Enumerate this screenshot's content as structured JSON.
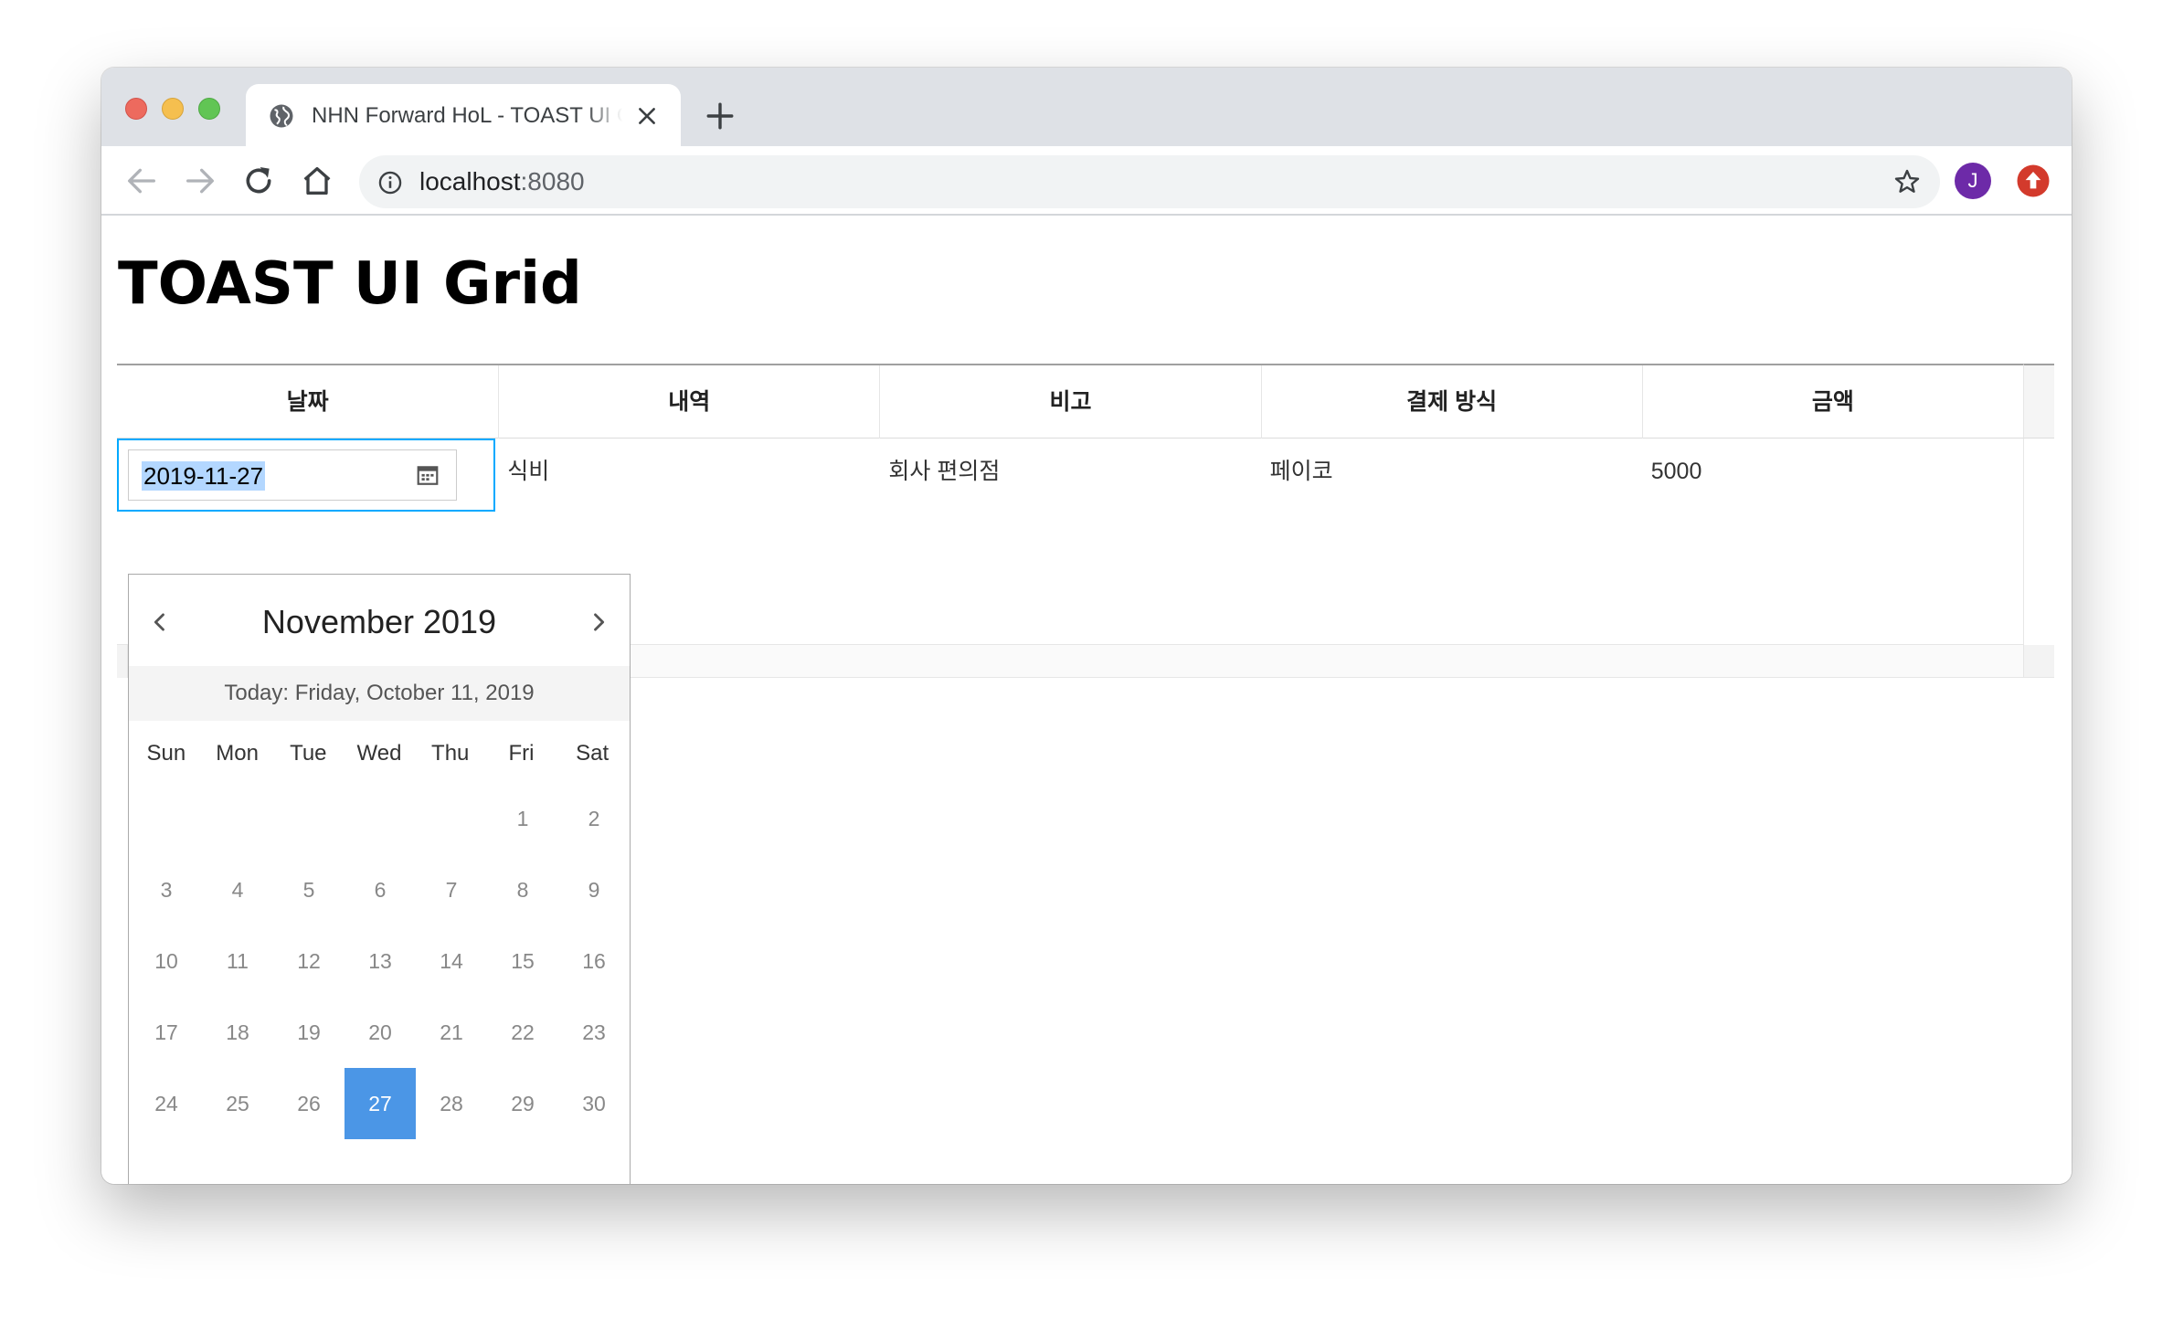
{
  "browser": {
    "tab_title": "NHN Forward HoL - TOAST UI Grid",
    "url_host": "localhost",
    "url_port": ":8080",
    "avatar_letter": "J"
  },
  "page": {
    "title": "TOAST UI Grid"
  },
  "grid": {
    "columns": [
      "날짜",
      "내역",
      "비고",
      "결제 방식",
      "금액"
    ],
    "rows": [
      [
        "2019-11-27",
        "식비",
        "회사 편의점",
        "페이코",
        "5000"
      ]
    ],
    "editing_value": "2019-11-27"
  },
  "datepicker": {
    "title": "November 2019",
    "today_label": "Today: Friday, October 11, 2019",
    "weekdays": [
      "Sun",
      "Mon",
      "Tue",
      "Wed",
      "Thu",
      "Fri",
      "Sat"
    ],
    "days": [
      "",
      "",
      "",
      "",
      "",
      "1",
      "2",
      "3",
      "4",
      "5",
      "6",
      "7",
      "8",
      "9",
      "10",
      "11",
      "12",
      "13",
      "14",
      "15",
      "16",
      "17",
      "18",
      "19",
      "20",
      "21",
      "22",
      "23",
      "24",
      "25",
      "26",
      "27",
      "28",
      "29",
      "30"
    ],
    "selected_day": "27",
    "selected_color": "#4b96e6"
  }
}
